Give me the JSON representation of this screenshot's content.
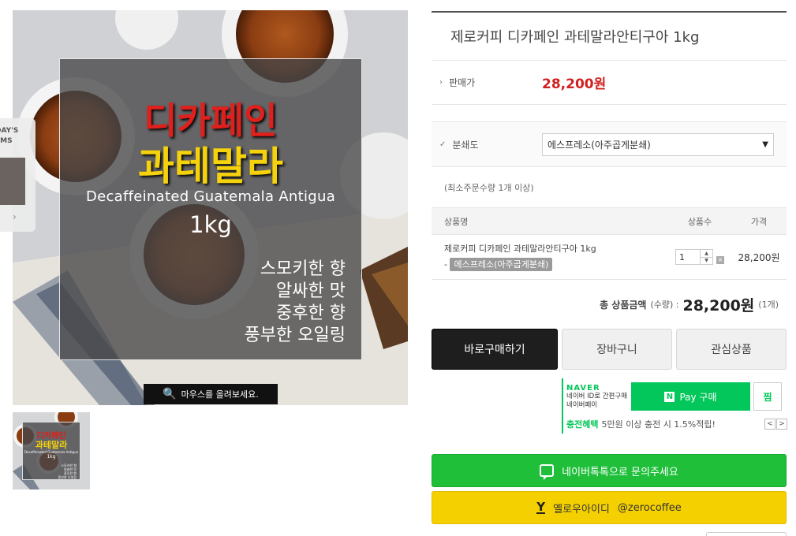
{
  "product_image": {
    "title_line1": "디카페인",
    "title_line2": "과테말라",
    "english_name": "Decaffeinated Guatemala Antigua",
    "weight": "1kg",
    "desc_lines": [
      "스모키한 향",
      "알싸한 맛",
      "중후한 향",
      "풍부한 오일링"
    ],
    "hover_hint": "마우스를 올려보세요."
  },
  "today_tab": {
    "text": "DAY'S\nEMS"
  },
  "product": {
    "title": "제로커피 디카페인 과테말라안티구아 1kg",
    "price_label": "판매가",
    "price": "28,200원"
  },
  "option": {
    "label": "분쇄도",
    "selected": "에스프레소(아주곱게분쇄)"
  },
  "min_order_note": "(최소주문수량 1개 이상)",
  "table": {
    "headers": {
      "name": "상품명",
      "qty": "상품수",
      "price": "가격"
    },
    "row": {
      "name": "제로커피 디카페인 과테말라안티구아 1kg",
      "option_prefix": "-",
      "option_tag": "에스프레소(아주곱게분쇄)",
      "qty": "1",
      "price": "28,200원"
    }
  },
  "total": {
    "label": "총 상품금액",
    "label2": "(수량) :",
    "value": "28,200원",
    "count": "(1개)"
  },
  "buttons": {
    "buy": "바로구매하기",
    "cart": "장바구니",
    "wish": "관심상품"
  },
  "npay": {
    "brand": "NAVER",
    "brand_sub1": "네이버 ID로 간편구매",
    "brand_sub2": "네이버페이",
    "pay_logo": "N",
    "pay_label": "Pay 구매",
    "jjim": "찜",
    "benefit_label": "충전혜택",
    "benefit_text": "5만원 이상 충전 시 1.5%적립!",
    "prev": "<",
    "next": ">"
  },
  "talk_button": "네이버톡톡으로 문의주세요",
  "yellow_button": {
    "icon": "Y",
    "name": "옐로우아이디",
    "id": "@zerocoffee"
  },
  "colors": {
    "price_red": "#d02020",
    "naver_green": "#03c75a",
    "talk_green": "#1fbf3a",
    "yellow": "#f5d000"
  }
}
